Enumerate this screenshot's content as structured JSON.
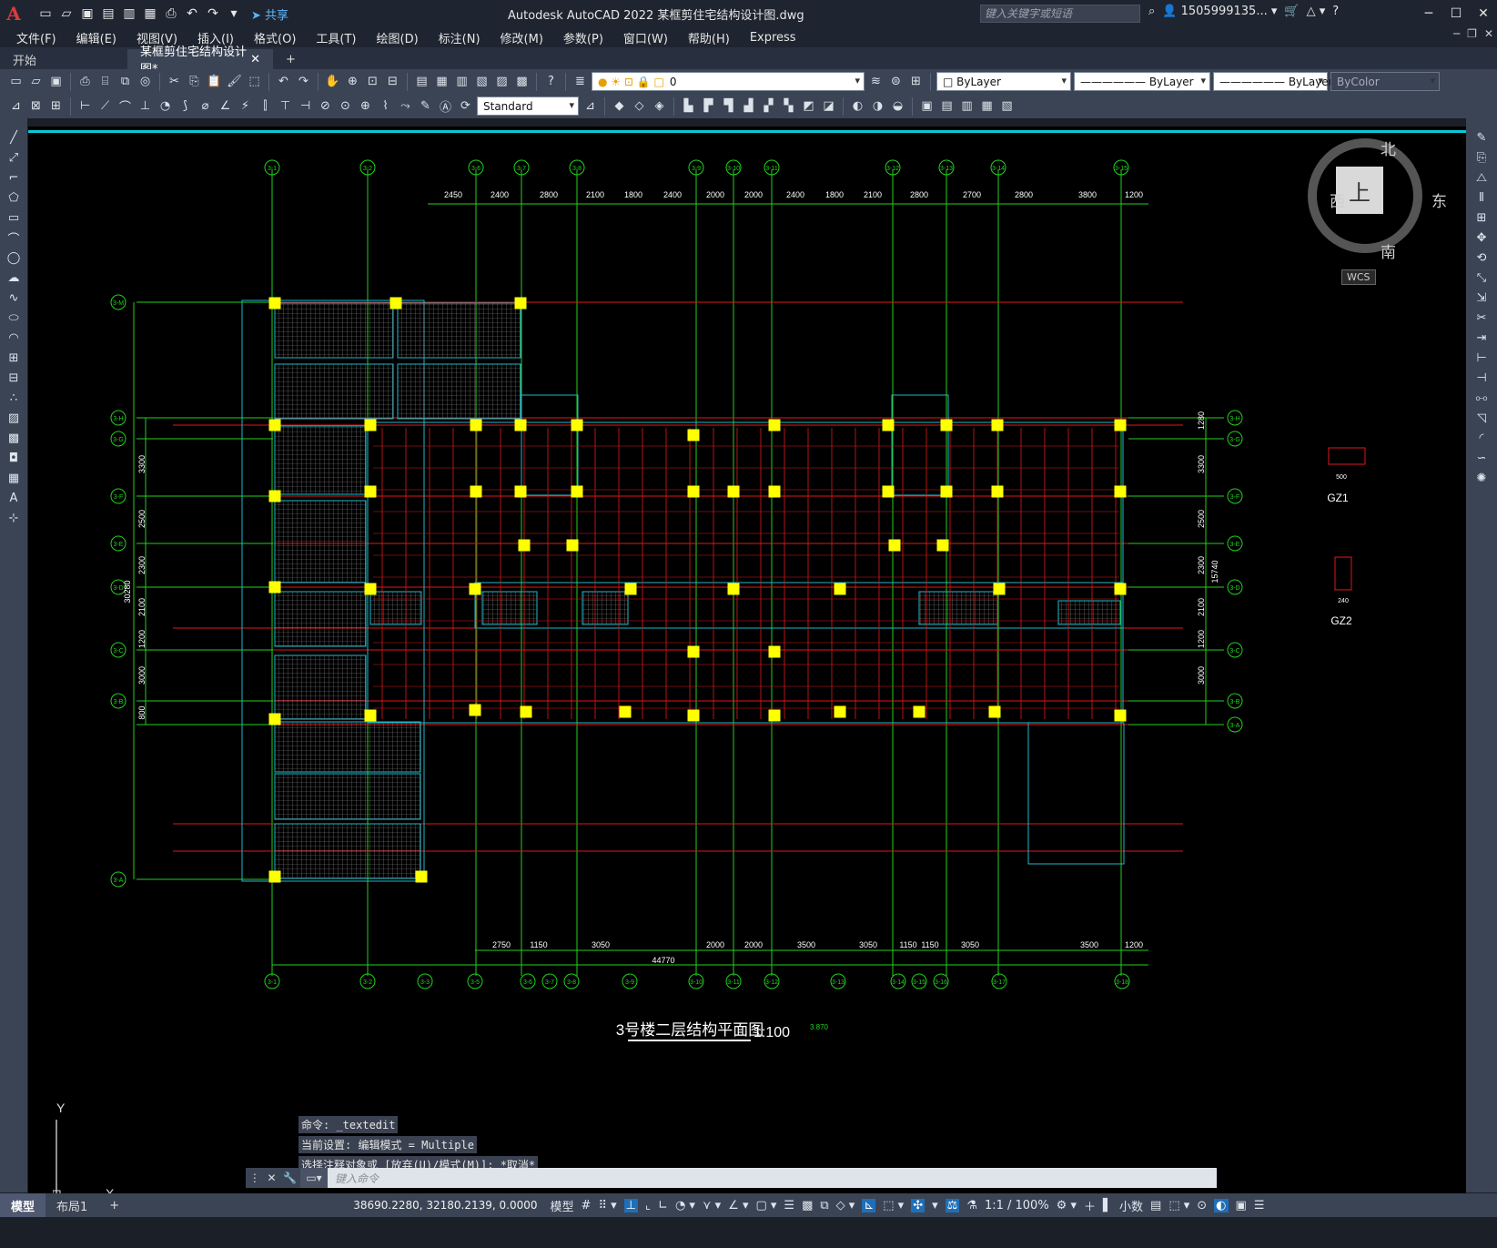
{
  "titlebar": {
    "logo": "A",
    "app_title": "Autodesk AutoCAD 2022    某框剪住宅结构设计图.dwg",
    "share_label": "共享",
    "search_placeholder": "键入关键字或短语",
    "user": "1505999135...",
    "help": "?"
  },
  "menu": [
    "文件(F)",
    "编辑(E)",
    "视图(V)",
    "插入(I)",
    "格式(O)",
    "工具(T)",
    "绘图(D)",
    "标注(N)",
    "修改(M)",
    "参数(P)",
    "窗口(W)",
    "帮助(H)",
    "Express"
  ],
  "tabs": {
    "start": "开始",
    "active": "某框剪住宅结构设计图*"
  },
  "toolbar": {
    "layer_value": "0",
    "color_value": "ByLayer",
    "linetype_value": "ByLayer",
    "lineweight_value": "ByLayer",
    "plotstyle_value": "ByColor",
    "textstyle_value": "Standard"
  },
  "viewcube": {
    "north": "北",
    "south": "南",
    "east": "东",
    "west": "西",
    "face": "上",
    "wcs": "WCS"
  },
  "drawing": {
    "title": "3号楼二层结构平面图",
    "scale": "1:100",
    "elevation": "3.870",
    "total_dim": "44770",
    "left_total_dim": "30280",
    "right_total_dim": "15740",
    "top_dims": [
      "2450",
      "2400",
      "2800",
      "2100",
      "1800",
      "2400",
      "2000",
      "2000",
      "2400",
      "1800",
      "2100",
      "2800",
      "2700",
      "2800",
      "3800",
      "1200"
    ],
    "bottom_dims": [
      "2750",
      "1150",
      "3050",
      "2000",
      "2000",
      "3500",
      "3050",
      "1150",
      "1150",
      "3050",
      "3500",
      "1200"
    ],
    "left_dims": [
      "3300",
      "2500",
      "2300",
      "2100",
      "1200",
      "3000",
      "800"
    ],
    "right_dims": [
      "3300",
      "2500",
      "2300",
      "2100",
      "1200",
      "3000",
      "1280"
    ],
    "top_axes": [
      "3-1",
      "3-2",
      "3-6",
      "3-7",
      "3-8",
      "3-9",
      "3-10",
      "3-11",
      "3-12",
      "3-13",
      "3-14",
      "3-15"
    ],
    "bottom_axes": [
      "3-1",
      "3-2",
      "3-3",
      "3-5",
      "3-6",
      "3-7",
      "3-8",
      "3-9",
      "3-10",
      "3-11",
      "3-12",
      "3-13",
      "3-14",
      "3-15",
      "3-16",
      "3-17",
      "3-18"
    ],
    "left_axes": [
      "3-M",
      "3-H",
      "3-G",
      "3-F",
      "3-E",
      "3-D",
      "3-C",
      "3-B",
      "3-A"
    ],
    "right_axes": [
      "3-H",
      "3-G",
      "3-F",
      "3-E",
      "3-D",
      "3-C",
      "3-B",
      "3-A"
    ],
    "gz1_label": "GZ1",
    "gz2_label": "GZ2",
    "gz1_size": "500",
    "gz2_size": "240"
  },
  "command": {
    "history": [
      "命令: _textedit",
      "当前设置: 编辑模式 = Multiple",
      "选择注释对象或 [放弃(U)/模式(M)]: *取消*"
    ],
    "placeholder": "键入命令"
  },
  "status": {
    "model_tab": "模型",
    "layout_tab": "布局1",
    "coords": "38690.2280, 32180.2139, 0.0000",
    "mode": "模型",
    "scale": "1:1 / 100%",
    "units": "小数"
  },
  "colors": {
    "accent": "#0cc9d8",
    "axis": "#22d11e",
    "wall": "#1fb8c8",
    "rebar": "#e01818",
    "column": "#ffff00",
    "canvas": "#000000"
  }
}
